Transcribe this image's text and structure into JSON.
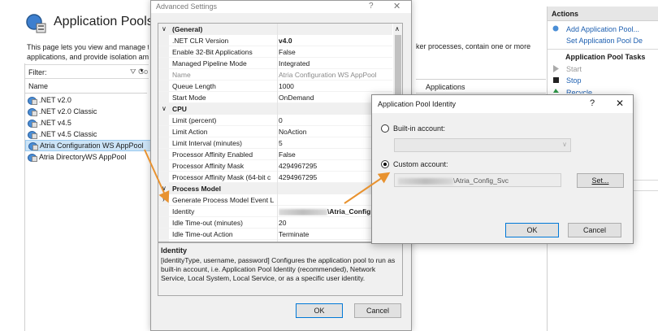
{
  "iis": {
    "title": "Application Pools",
    "description_line1": "This page lets you view and manage th",
    "description_line2": "applications, and provide isolation am",
    "description_right": "ker processes, contain one or more",
    "filter_label": "Filter:",
    "filter_go": "Go",
    "col_name": "Name",
    "col_applications": "Applications",
    "pools": [
      ".NET v2.0",
      ".NET v2.0 Classic",
      ".NET v4.5",
      ".NET v4.5 Classic",
      "Atria Configuration WS AppPool",
      "Atria DirectoryWS AppPool"
    ]
  },
  "actions": {
    "header": "Actions",
    "add_pool": "Add Application Pool...",
    "set_defaults": "Set Application Pool De",
    "tasks_header": "Application Pool Tasks",
    "start": "Start",
    "stop": "Stop",
    "recycle": "Recycle..."
  },
  "advanced": {
    "title": "Advanced Settings",
    "help": "?",
    "close": "✕",
    "general_cat": "(General)",
    "cpu_cat": "CPU",
    "process_cat": "Process Model",
    "general": [
      {
        "k": ".NET CLR Version",
        "v": "v4.0",
        "bold": true
      },
      {
        "k": "Enable 32-Bit Applications",
        "v": "False"
      },
      {
        "k": "Managed Pipeline Mode",
        "v": "Integrated"
      },
      {
        "k": "Name",
        "v": "Atria Configuration WS AppPool",
        "dim": true
      },
      {
        "k": "Queue Length",
        "v": "1000"
      },
      {
        "k": "Start Mode",
        "v": "OnDemand"
      }
    ],
    "cpu": [
      {
        "k": "Limit (percent)",
        "v": "0"
      },
      {
        "k": "Limit Action",
        "v": "NoAction"
      },
      {
        "k": "Limit Interval (minutes)",
        "v": "5"
      },
      {
        "k": "Processor Affinity Enabled",
        "v": "False"
      },
      {
        "k": "Processor Affinity Mask",
        "v": "4294967295"
      },
      {
        "k": "Processor Affinity Mask (64-bit c",
        "v": "4294967295"
      }
    ],
    "process": [
      {
        "k": "Generate Process Model Event L",
        "v": ""
      },
      {
        "k": "Identity",
        "v": "\\Atria_Config"
      },
      {
        "k": "Idle Time-out (minutes)",
        "v": "20"
      },
      {
        "k": "Idle Time-out Action",
        "v": "Terminate"
      }
    ],
    "desc_title": "Identity",
    "desc_text": "[identityType, username, password] Configures the application pool to run as built-in account, i.e. Application Pool Identity (recommended), Network Service, Local System, Local Service, or as a specific user identity.",
    "ok": "OK",
    "cancel": "Cancel"
  },
  "identity_dialog": {
    "title": "Application Pool Identity",
    "help": "?",
    "close": "✕",
    "builtin_label": "Built-in account:",
    "custom_label": "Custom account:",
    "custom_value": "\\Atria_Config_Svc",
    "set_button": "Set...",
    "ok": "OK",
    "cancel": "Cancel"
  },
  "colors": {
    "accent": "#0078d7",
    "selection": "#cce4f7",
    "arrow": "#e8922f",
    "link": "#1d5fb0"
  }
}
